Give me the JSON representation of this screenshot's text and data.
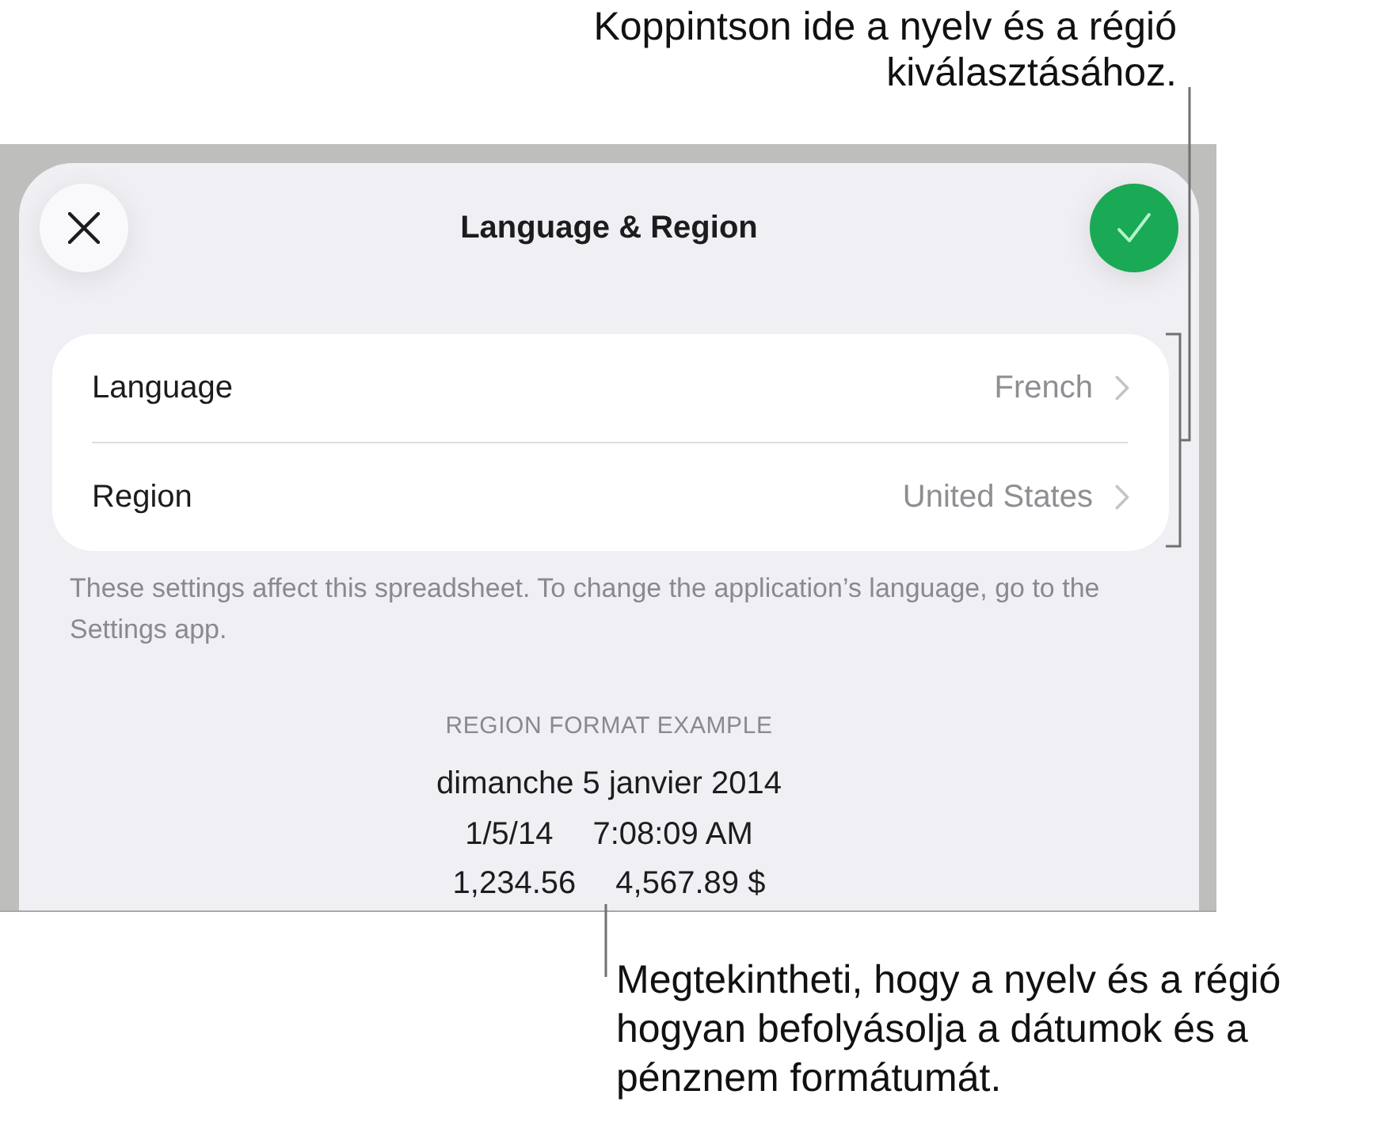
{
  "top_callout": {
    "text": "Koppintson ide a nyelv és a régió kiválasztásához."
  },
  "sheet": {
    "title": "Language & Region"
  },
  "settings": [
    {
      "label": "Language",
      "value": "French"
    },
    {
      "label": "Region",
      "value": "United States"
    }
  ],
  "footnote": "These settings affect this spreadsheet. To change the application’s language, go to the Settings app.",
  "format_example": {
    "heading": "REGION FORMAT EXAMPLE",
    "lines": [
      [
        "dimanche 5 janvier 2014"
      ],
      [
        "1/5/14",
        "7:08:09 AM"
      ],
      [
        "1,234.56",
        "4,567.89 $"
      ]
    ]
  },
  "bottom_callout": {
    "text": "Megtekintheti, hogy a nyelv és a régió hogyan befolyásolja a dátumok és a pénznem formátumát."
  }
}
